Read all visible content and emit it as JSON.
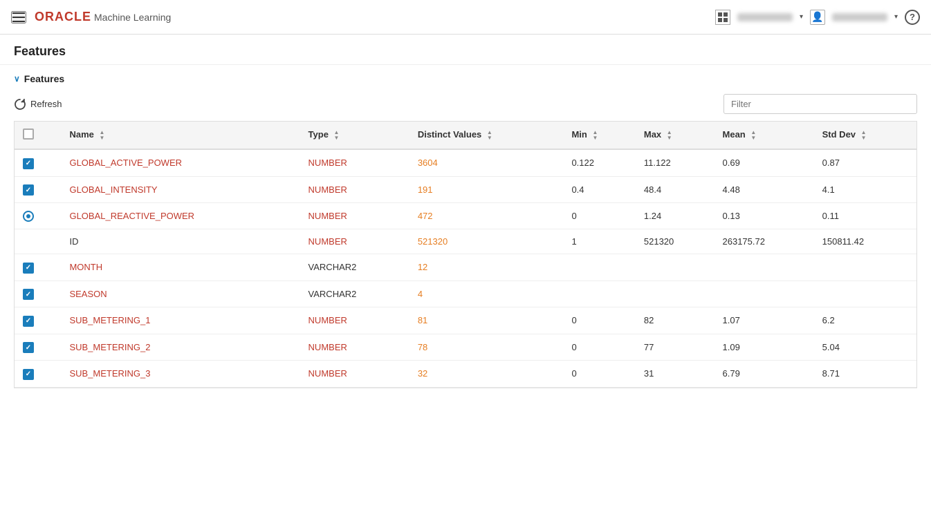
{
  "header": {
    "menu_icon": "hamburger",
    "brand_oracle": "ORACLE",
    "brand_ml": "Machine Learning",
    "grid_button_label": "",
    "user_button_label": "",
    "help_button_label": "?",
    "chevron_label": "▾"
  },
  "page": {
    "title": "Features"
  },
  "section": {
    "label": "Features",
    "chevron": "∨"
  },
  "toolbar": {
    "refresh_label": "Refresh",
    "filter_placeholder": "Filter"
  },
  "table": {
    "columns": [
      {
        "id": "checkbox",
        "label": ""
      },
      {
        "id": "name",
        "label": "Name"
      },
      {
        "id": "type",
        "label": "Type"
      },
      {
        "id": "distinct",
        "label": "Distinct Values"
      },
      {
        "id": "min",
        "label": "Min"
      },
      {
        "id": "max",
        "label": "Max"
      },
      {
        "id": "mean",
        "label": "Mean"
      },
      {
        "id": "stddev",
        "label": "Std Dev"
      }
    ],
    "rows": [
      {
        "checkbox": "checked",
        "name": "GLOBAL_ACTIVE_POWER",
        "type": "NUMBER",
        "distinct": "3604",
        "min": "0.122",
        "max": "11.122",
        "mean": "0.69",
        "stddev": "0.87"
      },
      {
        "checkbox": "checked",
        "name": "GLOBAL_INTENSITY",
        "type": "NUMBER",
        "distinct": "191",
        "min": "0.4",
        "max": "48.4",
        "mean": "4.48",
        "stddev": "4.1"
      },
      {
        "checkbox": "circle",
        "name": "GLOBAL_REACTIVE_POWER",
        "type": "NUMBER",
        "distinct": "472",
        "min": "0",
        "max": "1.24",
        "mean": "0.13",
        "stddev": "0.11"
      },
      {
        "checkbox": "none",
        "name": "ID",
        "type": "NUMBER",
        "distinct": "521320",
        "min": "1",
        "max": "521320",
        "mean": "263175.72",
        "stddev": "150811.42"
      },
      {
        "checkbox": "checked",
        "name": "MONTH",
        "type": "VARCHAR2",
        "distinct": "12",
        "min": "",
        "max": "",
        "mean": "",
        "stddev": ""
      },
      {
        "checkbox": "checked",
        "name": "SEASON",
        "type": "VARCHAR2",
        "distinct": "4",
        "min": "",
        "max": "",
        "mean": "",
        "stddev": ""
      },
      {
        "checkbox": "checked",
        "name": "SUB_METERING_1",
        "type": "NUMBER",
        "distinct": "81",
        "min": "0",
        "max": "82",
        "mean": "1.07",
        "stddev": "6.2"
      },
      {
        "checkbox": "checked",
        "name": "SUB_METERING_2",
        "type": "NUMBER",
        "distinct": "78",
        "min": "0",
        "max": "77",
        "mean": "1.09",
        "stddev": "5.04"
      },
      {
        "checkbox": "checked",
        "name": "SUB_METERING_3",
        "type": "NUMBER",
        "distinct": "32",
        "min": "0",
        "max": "31",
        "mean": "6.79",
        "stddev": "8.71"
      }
    ]
  }
}
